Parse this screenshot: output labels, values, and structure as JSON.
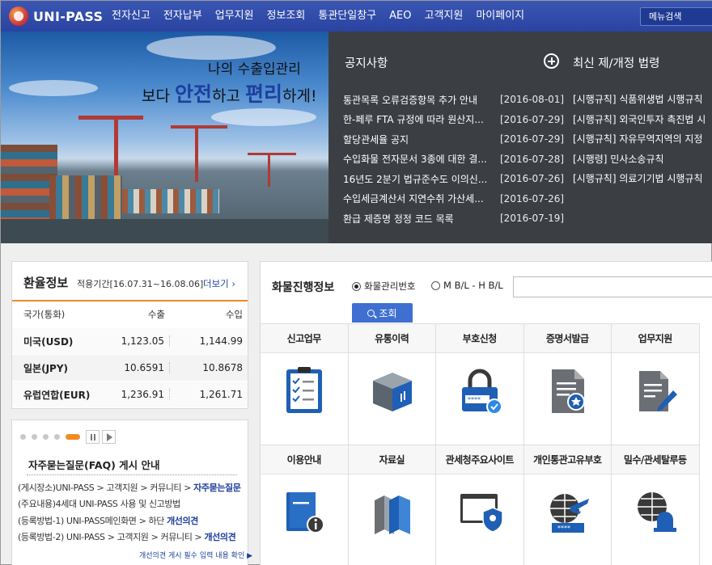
{
  "nav": {
    "logo": "UNI-PASS",
    "items": [
      "전자신고",
      "전자납부",
      "업무지원",
      "정보조회",
      "통관단일창구",
      "AEO",
      "고객지원",
      "마이페이지"
    ],
    "search_label": "메뉴검색"
  },
  "banner": {
    "slogan_line1": "나의 수출입관리",
    "slogan_pre": "보다 ",
    "slogan_hl1": "안전",
    "slogan_mid": "하고 ",
    "slogan_hl2": "편리",
    "slogan_post": "하게!"
  },
  "notices": {
    "title": "공지사항",
    "items": [
      {
        "title": "통관목록 오류검증항목 추가 안내",
        "date": "[2016-08-01]"
      },
      {
        "title": "한-페루 FTA 규정에 따라 원산지...",
        "date": "[2016-07-29]"
      },
      {
        "title": "할당관세율 공지",
        "date": "[2016-07-29]"
      },
      {
        "title": "수입화물 전자문서 3종에 대한 결...",
        "date": "[2016-07-28]"
      },
      {
        "title": "16년도 2분기 법규준수도 이의신...",
        "date": "[2016-07-26]"
      },
      {
        "title": "수입세금계산서 지연수취 가산세...",
        "date": "[2016-07-26]"
      },
      {
        "title": "환급 제증명 정정 코드 목록",
        "date": "[2016-07-19]"
      }
    ]
  },
  "laws": {
    "title": "최신 제/개정 법령",
    "items": [
      "[시행규칙] 식품위생법 시행규칙",
      "[시행규칙] 외국인투자 촉진법 시",
      "[시행규칙] 자유무역지역의 지정",
      "[시행령] 민사소송규칙",
      "[시행규칙] 의료기기법 시행규칙"
    ]
  },
  "fx": {
    "title": "환율정보",
    "period": "적용기간[16.07.31~16.08.06]",
    "more": "더보기 ›",
    "headers": [
      "국가(통화)",
      "수출",
      "수입"
    ],
    "rows": [
      {
        "country": "미국(USD)",
        "export": "1,123.05",
        "import": "1,144.99"
      },
      {
        "country": "일본(JPY)",
        "export": "10.6591",
        "import": "10.8678"
      },
      {
        "country": "유럽연합(EUR)",
        "export": "1,236.91",
        "import": "1,261.71"
      }
    ]
  },
  "faq": {
    "title": "자주묻는질문(FAQ) 게시 안내",
    "lines": [
      {
        "pre": "(게시장소)UNI-PASS > 고객지원 > 커뮤니티 > ",
        "bold": "자주묻는질문"
      },
      {
        "pre": "(주요내용)4세대 UNI-PASS 사용 및 신고방법",
        "bold": ""
      },
      {
        "pre": "(등록방법-1) UNI-PASS메인화면 > 하단 ",
        "bold": "개선의견"
      },
      {
        "pre": "(등록방법-2) UNI-PASS > 고객지원 > 커뮤니티 > ",
        "bold": "개선의견"
      }
    ],
    "note": "개선의견 게시 필수 입력 내용 확인 ▶"
  },
  "cargo": {
    "title": "화물진행정보",
    "radio1": "화물관리번호",
    "radio2": "M B/L - H B/L",
    "search_label": "조회",
    "tiles_row1": [
      "신고업무",
      "유통이력",
      "부호신청",
      "증명서발급",
      "업무지원"
    ],
    "tiles_row2": [
      "이용안내",
      "자료실",
      "관세청주요사이트",
      "개인통관고유부호",
      "밀수/관세탈루등"
    ]
  }
}
